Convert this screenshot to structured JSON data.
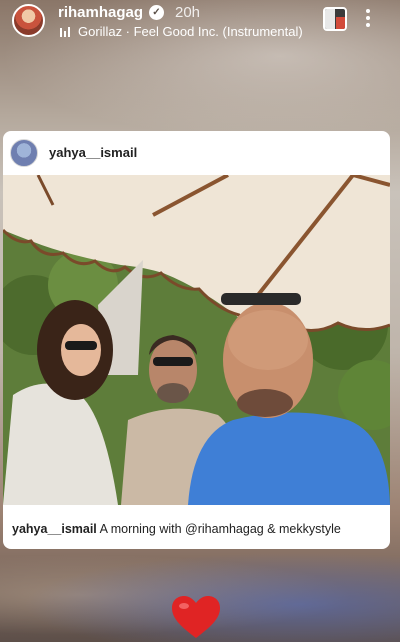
{
  "header": {
    "username": "rihamhagag",
    "verified_icon": "verified-badge-icon",
    "time": "20h",
    "music": "Gorillaz · Feel Good Inc. (Instrumental)"
  },
  "post": {
    "username": "yahya__ismail",
    "caption_user": "yahya__ismail",
    "caption_text": " A morning with @rihamhagag & mekkystyle"
  },
  "reaction": {
    "icon": "heart-icon",
    "color": "#e02424"
  }
}
